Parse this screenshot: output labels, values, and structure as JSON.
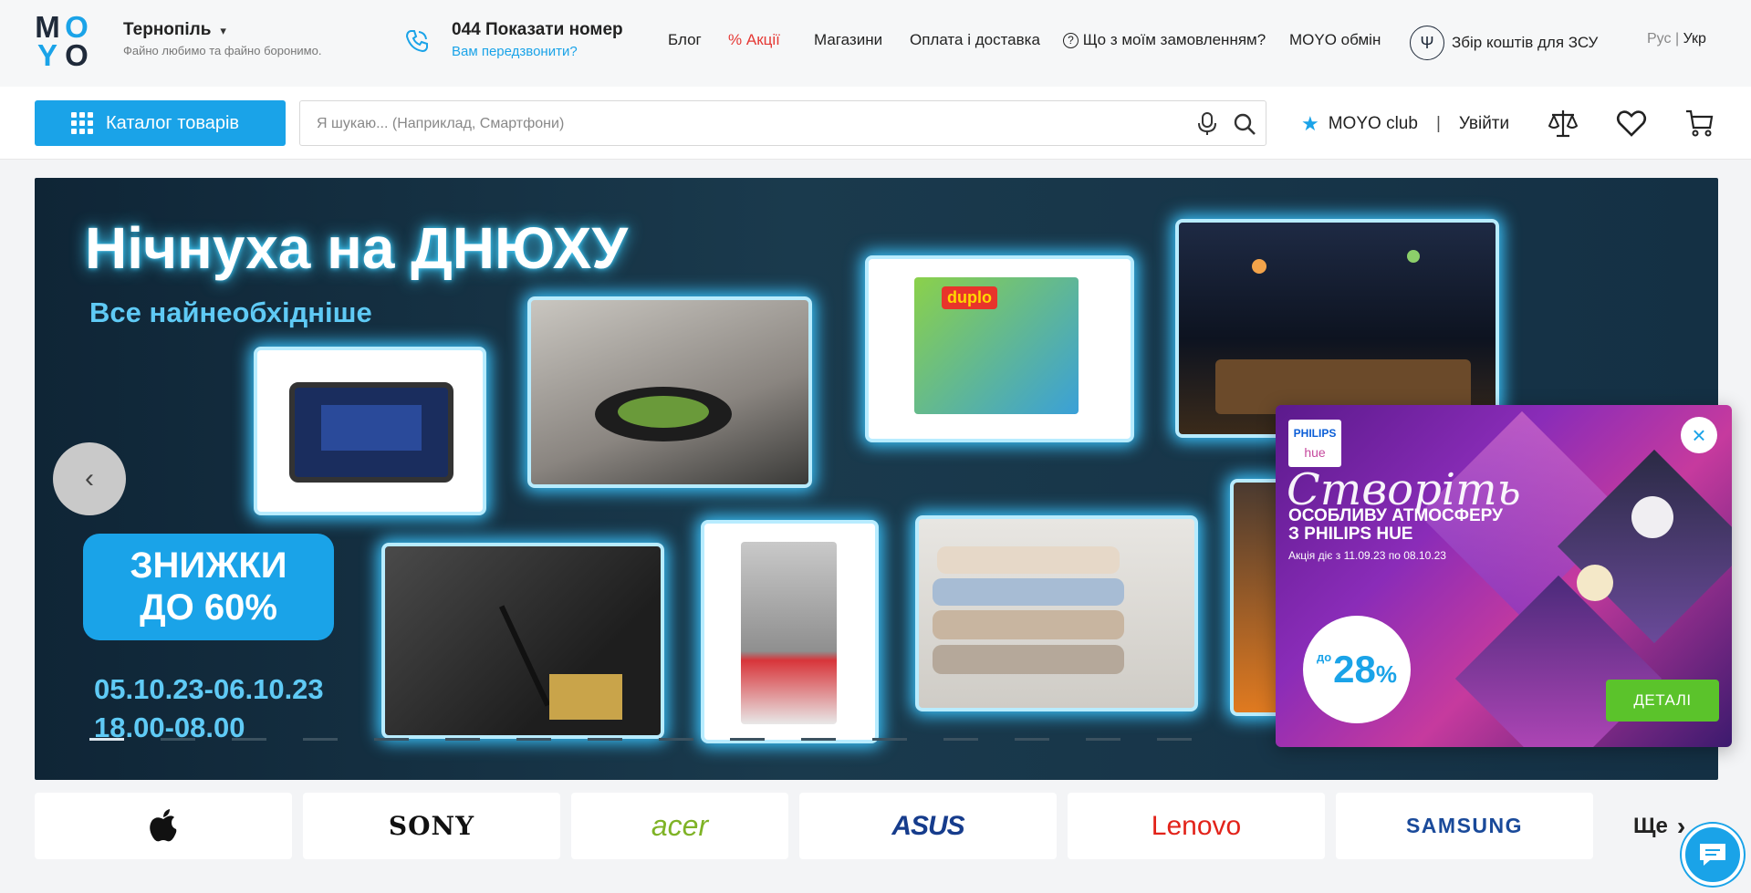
{
  "header": {
    "logo_letters": [
      "M",
      "O",
      "Y",
      "O"
    ],
    "city": "Тернопіль",
    "tagline": "Файно любимо та файно боронимо.",
    "phone": "044 Показати номер",
    "callback": "Вам передзвонити?",
    "nav": {
      "blog": "Блог",
      "promo": "Акції",
      "stores": "Магазини",
      "delivery": "Оплата і доставка",
      "order": "Що з моїм замовленням?",
      "exchange": "MOYO обмін",
      "donate": "Збір коштів для ЗСУ"
    },
    "lang": {
      "ru": "Рус",
      "sep": "|",
      "ua": "Укр"
    }
  },
  "toolbar": {
    "catalog_label": "Каталог товарів",
    "search_placeholder": "Я шукаю... (Наприклад, Смартфони)",
    "club_label": "MOYO club",
    "sep": "|",
    "login_label": "Увійти"
  },
  "banner": {
    "title": "Нічнуха на ДНЮХУ",
    "subtitle": "Все найнеобхідніше",
    "discount_line1": "ЗНИЖКИ",
    "discount_line2": "ДО 60%",
    "dates_line1": "05.10.23-06.10.23",
    "dates_line2": "18.00-08.00",
    "duplo_text": "duplo"
  },
  "popup": {
    "brand": "PHILIPS",
    "brand_sub": "hue",
    "script": "Створіть",
    "headline1": "ОСОБЛИВУ АТМОСФЕРУ",
    "headline2": "З PHILIPS HUE",
    "promo_dates": "Акція діє з 11.09.23 по 08.10.23",
    "discount_prefix": "до",
    "discount_value": "28",
    "discount_unit": "%",
    "close_icon": "×",
    "details_label": "ДЕТАЛІ"
  },
  "brands": {
    "sony": "SONY",
    "acer": "acer",
    "asus": "ASUS",
    "lenovo": "Lenovo",
    "samsung": "SAMSUNG",
    "more": "Ще"
  },
  "colors": {
    "accent": "#1aa3e8",
    "promo_red": "#e53935",
    "details_green": "#5bc32b"
  }
}
